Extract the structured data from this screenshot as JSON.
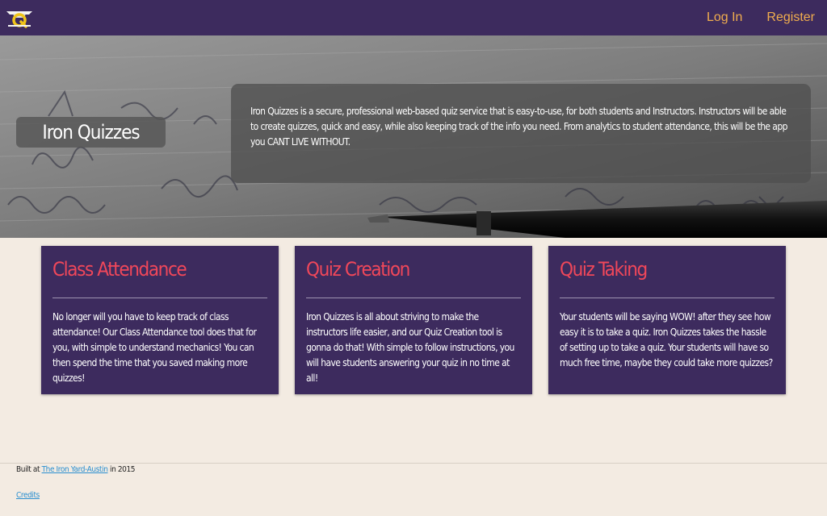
{
  "nav": {
    "logo_icon": "iron-q-logo-icon",
    "login_label": "Log In",
    "register_label": "Register"
  },
  "hero": {
    "title": "Iron Quizzes",
    "description": "Iron Quizzes is a secure, professional web-based quiz service that is easy-to-use, for both students and Instructors. Instructors will be able to create quizzes, quick and easy, while also keeping track of the info you need. From analytics to student attendance, this will be the app you CANT LIVE WITHOUT."
  },
  "cards": [
    {
      "title": "Class Attendance",
      "text": "No longer will you have to keep track of class attendance! Our Class Attendance tool does that for you, with simple to understand mechanics! You can then spend the time that you saved making more quizzes!"
    },
    {
      "title": "Quiz Creation",
      "text": "Iron Quizzes is all about striving to make the instructors life easier, and our Quiz Creation tool is gonna do that! With simple to follow instructions, you will have students answering your quiz in no time at all!"
    },
    {
      "title": "Quiz Taking",
      "text": "Your students will be saying WOW! after they see how easy it is to take a quiz. Iron Quizzes takes the hassle of setting up to take a quiz. Your students will have so much free time, maybe they could take more quizzes?"
    }
  ],
  "footer": {
    "built_prefix": "Built at ",
    "built_link": "The Iron Yard-Austin",
    "built_suffix": " in 2015",
    "credits_link": "Credits"
  },
  "colors": {
    "nav_bg": "#3d2b5e",
    "nav_link": "#f0ad4e",
    "card_bg": "#3d2b5e",
    "card_title": "#f0475a",
    "page_bg": "#f3ebe2",
    "footer_link": "#2a8fd0"
  }
}
